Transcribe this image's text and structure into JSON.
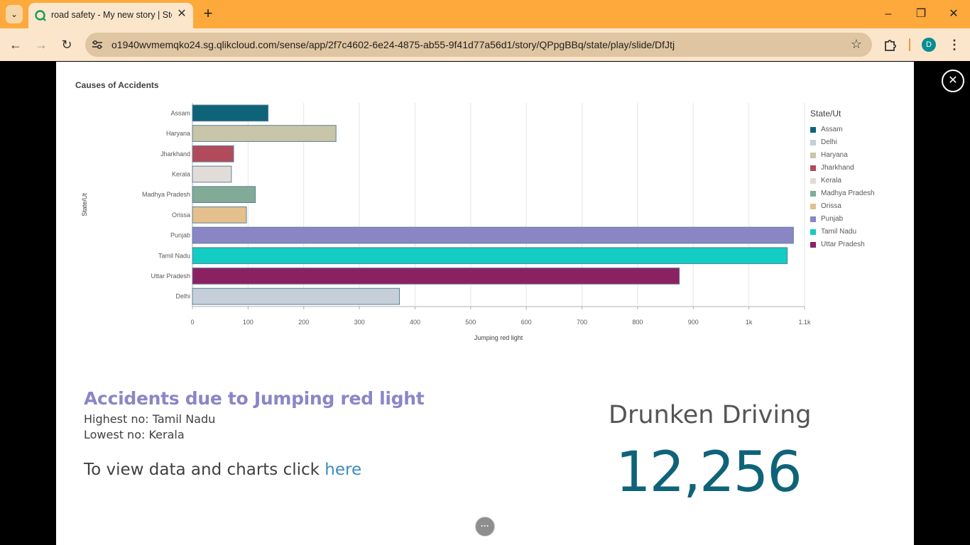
{
  "browser": {
    "tab_title": "road safety - My new story | Sto",
    "url": "o1940wvmemqko24.sg.qlikcloud.com/sense/app/2f7c4602-6e24-4875-ab55-9f41d77a56d1/story/QPpgBBq/state/play/slide/DfJtj",
    "avatar_letter": "D",
    "tabbar_color": "#fea93c",
    "toolbar_color": "#fbe6cc"
  },
  "chart_data": {
    "type": "bar",
    "orientation": "horizontal",
    "title": "Causes of Accidents",
    "xlabel": "Jumping red light",
    "ylabel": "State/Ut",
    "categories": [
      "Assam",
      "Haryana",
      "Jharkhand",
      "Kerala",
      "Madhya Pradesh",
      "Orissa",
      "Punjab",
      "Tamil Nadu",
      "Uttar Pradesh",
      "Delhi"
    ],
    "values": [
      136,
      258,
      74,
      70,
      113,
      97,
      1080,
      1069,
      875,
      372
    ],
    "colors": [
      "#0f6379",
      "#c8c5a8",
      "#b14b5b",
      "#e2dcd9",
      "#81ab97",
      "#e3c08c",
      "#8a86c6",
      "#13ccc4",
      "#8c2162",
      "#c4cfda"
    ],
    "xticks": [
      "0",
      "100",
      "200",
      "300",
      "400",
      "500",
      "600",
      "700",
      "800",
      "900",
      "1k",
      "1.1k"
    ],
    "xlim": [
      0,
      1100
    ],
    "grid": true,
    "legend": {
      "title": "State/Ut",
      "placement": "right",
      "items": [
        {
          "label": "Assam",
          "color": "#0f6379"
        },
        {
          "label": "Delhi",
          "color": "#c4cfda"
        },
        {
          "label": "Haryana",
          "color": "#c8c5a8"
        },
        {
          "label": "Jharkhand",
          "color": "#b14b5b"
        },
        {
          "label": "Kerala",
          "color": "#e2dcd9"
        },
        {
          "label": "Madhya Pradesh",
          "color": "#81ab97"
        },
        {
          "label": "Orissa",
          "color": "#e3c08c"
        },
        {
          "label": "Punjab",
          "color": "#8a86c6"
        },
        {
          "label": "Tamil Nadu",
          "color": "#13ccc4"
        },
        {
          "label": "Uttar Pradesh",
          "color": "#8c2162"
        }
      ]
    }
  },
  "text_panel": {
    "heading": "Accidents due to Jumping red light",
    "highest": "Highest no: Tamil Nadu",
    "lowest": "Lowest no: Kerala",
    "view_prefix": "To view data and charts click ",
    "view_link": "here"
  },
  "kpi": {
    "title": "Drunken Driving",
    "value": "12,256"
  },
  "more_button": "···"
}
